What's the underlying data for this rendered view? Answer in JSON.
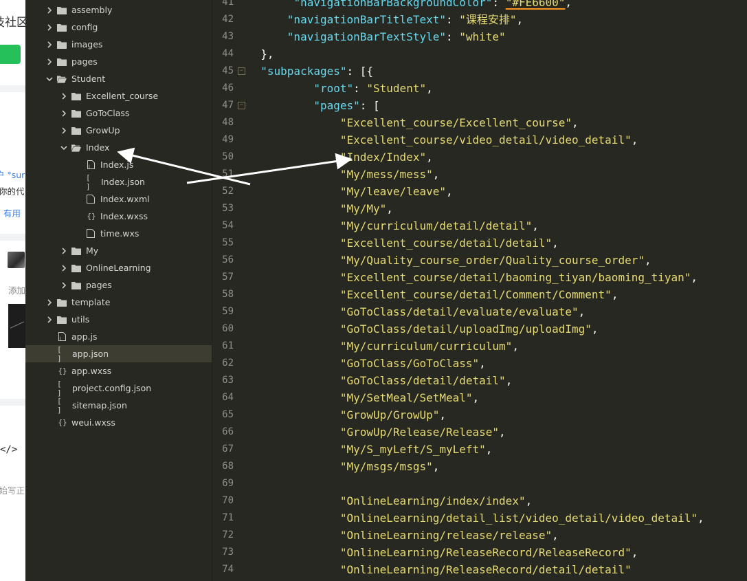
{
  "background_page": {
    "snippets": [
      "技社区",
      "户 °sur",
      "你的代",
      "有用",
      "添加",
      "</>",
      "开始写正"
    ]
  },
  "file_tree": {
    "items": [
      {
        "label": "assembly",
        "type": "folder",
        "depth": 1,
        "expanded": false
      },
      {
        "label": "config",
        "type": "folder",
        "depth": 1,
        "expanded": false
      },
      {
        "label": "images",
        "type": "folder",
        "depth": 1,
        "expanded": false
      },
      {
        "label": "pages",
        "type": "folder",
        "depth": 1,
        "expanded": false
      },
      {
        "label": "Student",
        "type": "folder",
        "depth": 1,
        "expanded": true
      },
      {
        "label": "Excellent_course",
        "type": "folder",
        "depth": 2,
        "expanded": false
      },
      {
        "label": "GoToClass",
        "type": "folder",
        "depth": 2,
        "expanded": false
      },
      {
        "label": "GrowUp",
        "type": "folder",
        "depth": 2,
        "expanded": false
      },
      {
        "label": "Index",
        "type": "folder",
        "depth": 2,
        "expanded": true
      },
      {
        "label": "Index.js",
        "type": "js",
        "depth": 3
      },
      {
        "label": "Index.json",
        "type": "json",
        "depth": 3
      },
      {
        "label": "Index.wxml",
        "type": "wxml",
        "depth": 3
      },
      {
        "label": "Index.wxss",
        "type": "wxss",
        "depth": 3
      },
      {
        "label": "time.wxs",
        "type": "wxs",
        "depth": 3
      },
      {
        "label": "My",
        "type": "folder",
        "depth": 2,
        "expanded": false
      },
      {
        "label": "OnlineLearning",
        "type": "folder",
        "depth": 2,
        "expanded": false
      },
      {
        "label": "pages",
        "type": "folder",
        "depth": 2,
        "expanded": false
      },
      {
        "label": "template",
        "type": "folder",
        "depth": 1,
        "expanded": false
      },
      {
        "label": "utils",
        "type": "folder",
        "depth": 1,
        "expanded": false
      },
      {
        "label": "app.js",
        "type": "js",
        "depth": 1
      },
      {
        "label": "app.json",
        "type": "json",
        "depth": 1,
        "selected": true
      },
      {
        "label": "app.wxss",
        "type": "wxss",
        "depth": 1
      },
      {
        "label": "project.config.json",
        "type": "json",
        "depth": 1
      },
      {
        "label": "sitemap.json",
        "type": "json",
        "depth": 1
      },
      {
        "label": "weui.wxss",
        "type": "wxss",
        "depth": 1
      }
    ]
  },
  "editor": {
    "lines": [
      {
        "n": "41",
        "indent": "       ",
        "key": "\"navigationBarBackgroundColor\"",
        "sep": ": ",
        "val": "\"#FE6600\"",
        "tail": ",",
        "val_error": true
      },
      {
        "n": "42",
        "indent": "      ",
        "key": "\"navigationBarTitleText\"",
        "sep": ": ",
        "val": "\"课程安排\"",
        "tail": ","
      },
      {
        "n": "43",
        "indent": "      ",
        "key": "\"navigationBarTextStyle\"",
        "sep": ": ",
        "val": "\"white\"",
        "tail": ""
      },
      {
        "n": "44",
        "indent": "  ",
        "key": "",
        "sep": "",
        "val": "",
        "tail": "},"
      },
      {
        "n": "45",
        "indent": "  ",
        "key": "\"subpackages\"",
        "sep": ": ",
        "val": "",
        "tail": "[{",
        "fold": true
      },
      {
        "n": "46",
        "indent": "          ",
        "key": "\"root\"",
        "sep": ": ",
        "val": "\"Student\"",
        "tail": ","
      },
      {
        "n": "47",
        "indent": "          ",
        "key": "\"pages\"",
        "sep": ": ",
        "val": "",
        "tail": "[",
        "fold": true
      },
      {
        "n": "48",
        "indent": "              ",
        "key": "",
        "sep": "",
        "val": "\"Excellent_course/Excellent_course\"",
        "tail": ","
      },
      {
        "n": "49",
        "indent": "              ",
        "key": "",
        "sep": "",
        "val": "\"Excellent_course/video_detail/video_detail\"",
        "tail": ","
      },
      {
        "n": "50",
        "indent": "              ",
        "key": "",
        "sep": "",
        "val": "\"Index/Index\"",
        "tail": ","
      },
      {
        "n": "51",
        "indent": "              ",
        "key": "",
        "sep": "",
        "val": "\"My/mess/mess\"",
        "tail": ","
      },
      {
        "n": "52",
        "indent": "              ",
        "key": "",
        "sep": "",
        "val": "\"My/leave/leave\"",
        "tail": ","
      },
      {
        "n": "53",
        "indent": "              ",
        "key": "",
        "sep": "",
        "val": "\"My/My\"",
        "tail": ","
      },
      {
        "n": "54",
        "indent": "              ",
        "key": "",
        "sep": "",
        "val": "\"My/curriculum/detail/detail\"",
        "tail": ","
      },
      {
        "n": "55",
        "indent": "              ",
        "key": "",
        "sep": "",
        "val": "\"Excellent_course/detail/detail\"",
        "tail": ","
      },
      {
        "n": "56",
        "indent": "              ",
        "key": "",
        "sep": "",
        "val": "\"My/Quality_course_order/Quality_course_order\"",
        "tail": ","
      },
      {
        "n": "57",
        "indent": "              ",
        "key": "",
        "sep": "",
        "val": "\"Excellent_course/detail/baoming_tiyan/baoming_tiyan\"",
        "tail": ","
      },
      {
        "n": "58",
        "indent": "              ",
        "key": "",
        "sep": "",
        "val": "\"Excellent_course/detail/Comment/Comment\"",
        "tail": ","
      },
      {
        "n": "59",
        "indent": "              ",
        "key": "",
        "sep": "",
        "val": "\"GoToClass/detail/evaluate/evaluate\"",
        "tail": ","
      },
      {
        "n": "60",
        "indent": "              ",
        "key": "",
        "sep": "",
        "val": "\"GoToClass/detail/uploadImg/uploadImg\"",
        "tail": ","
      },
      {
        "n": "61",
        "indent": "              ",
        "key": "",
        "sep": "",
        "val": "\"My/curriculum/curriculum\"",
        "tail": ","
      },
      {
        "n": "62",
        "indent": "              ",
        "key": "",
        "sep": "",
        "val": "\"GoToClass/GoToClass\"",
        "tail": ","
      },
      {
        "n": "63",
        "indent": "              ",
        "key": "",
        "sep": "",
        "val": "\"GoToClass/detail/detail\"",
        "tail": ","
      },
      {
        "n": "64",
        "indent": "              ",
        "key": "",
        "sep": "",
        "val": "\"My/SetMeal/SetMeal\"",
        "tail": ","
      },
      {
        "n": "65",
        "indent": "              ",
        "key": "",
        "sep": "",
        "val": "\"GrowUp/GrowUp\"",
        "tail": ","
      },
      {
        "n": "66",
        "indent": "              ",
        "key": "",
        "sep": "",
        "val": "\"GrowUp/Release/Release\"",
        "tail": ","
      },
      {
        "n": "67",
        "indent": "              ",
        "key": "",
        "sep": "",
        "val": "\"My/S_myLeft/S_myLeft\"",
        "tail": ","
      },
      {
        "n": "68",
        "indent": "              ",
        "key": "",
        "sep": "",
        "val": "\"My/msgs/msgs\"",
        "tail": ","
      },
      {
        "n": "69",
        "indent": "",
        "key": "",
        "sep": "",
        "val": "",
        "tail": ""
      },
      {
        "n": "70",
        "indent": "              ",
        "key": "",
        "sep": "",
        "val": "\"OnlineLearning/index/index\"",
        "tail": ","
      },
      {
        "n": "71",
        "indent": "              ",
        "key": "",
        "sep": "",
        "val": "\"OnlineLearning/detail_list/video_detail/video_detail\"",
        "tail": ","
      },
      {
        "n": "72",
        "indent": "              ",
        "key": "",
        "sep": "",
        "val": "\"OnlineLearning/release/release\"",
        "tail": ","
      },
      {
        "n": "73",
        "indent": "              ",
        "key": "",
        "sep": "",
        "val": "\"OnlineLearning/ReleaseRecord/ReleaseRecord\"",
        "tail": ","
      },
      {
        "n": "74",
        "indent": "              ",
        "key": "",
        "sep": "",
        "val": "\"OnlineLearning/ReleaseRecord/detail/detail\"",
        "tail": ""
      }
    ]
  },
  "colors": {
    "editor_bg": "#272822",
    "key": "#66d9ef",
    "string": "#e6db74",
    "punct": "#f8f8f2",
    "line_number": "#8f908a",
    "selected_row": "#3e3d32",
    "error_underline": "#fd971f",
    "annotation_arrow": "#ffffff"
  }
}
